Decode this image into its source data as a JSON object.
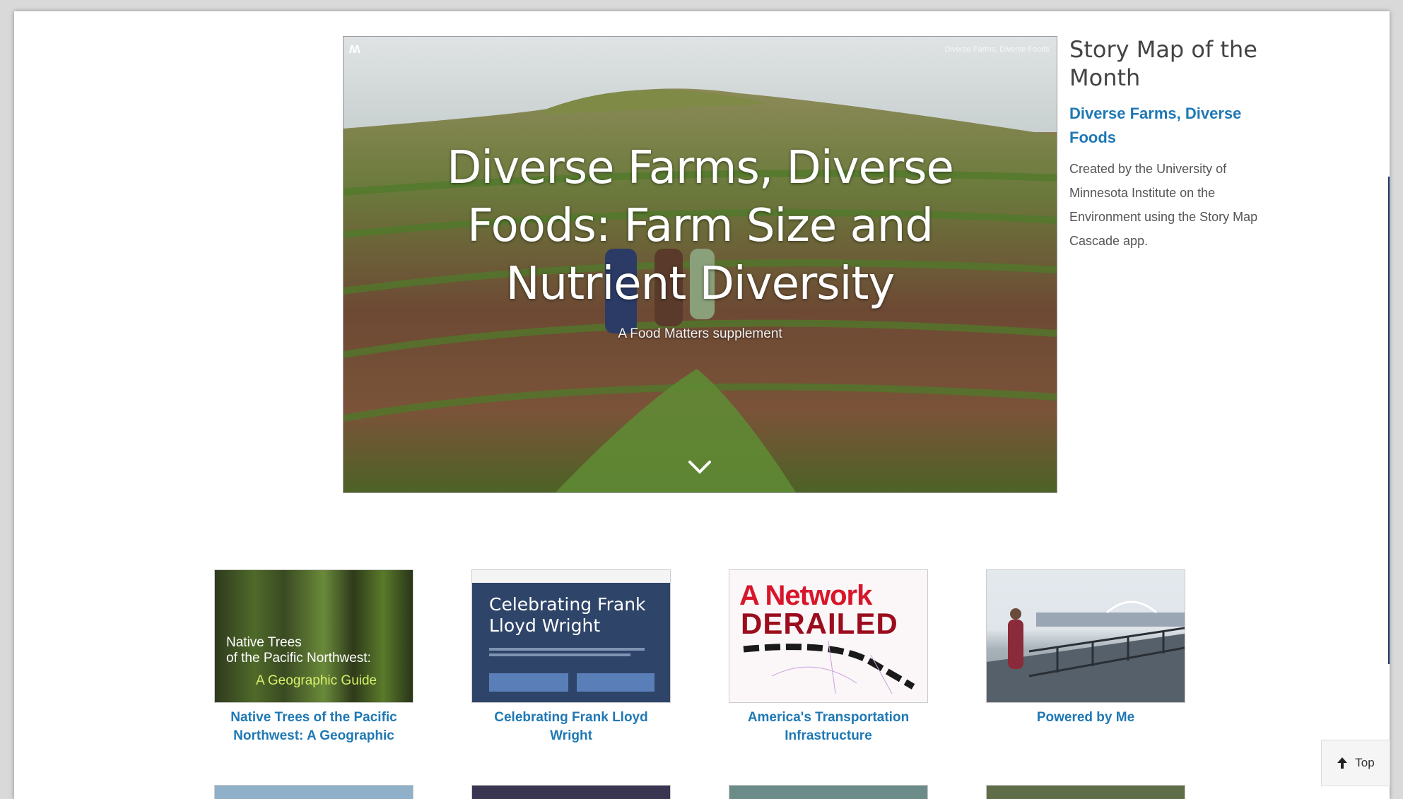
{
  "hero": {
    "title": "Diverse Farms, Diverse Foods: Farm Size and Nutrient Diversity",
    "subtitle": "A Food Matters supplement",
    "share_text": "Diverse Farms, Diverse Foods",
    "logo_icon": "story-map-logo-icon",
    "scroll_icon": "chevron-down-icon"
  },
  "side": {
    "heading": "Story Map of the Month",
    "link": "Diverse Farms, Diverse Foods",
    "description": "Created by the University of Minnesota Institute on the Environment using the Story Map Cascade app."
  },
  "gallery": {
    "cards": [
      {
        "title": "Native Trees of the Pacific Northwest: A Geographic",
        "thumb_line1": "Native Trees",
        "thumb_line2": "of the Pacific Northwest:",
        "thumb_line3": "A Geographic Guide"
      },
      {
        "title": "Celebrating Frank Lloyd Wright",
        "thumb_line1": "Celebrating Frank",
        "thumb_line2": "Lloyd Wright"
      },
      {
        "title": "America's Transportation Infrastructure",
        "thumb_line1": "A Network",
        "thumb_line2": "DERAILED"
      },
      {
        "title": "Powered by Me"
      }
    ]
  },
  "top_button": {
    "label": "Top",
    "icon": "arrow-up-icon"
  },
  "colors": {
    "link": "#1f78b4",
    "heading": "#444444",
    "text": "#555555"
  }
}
